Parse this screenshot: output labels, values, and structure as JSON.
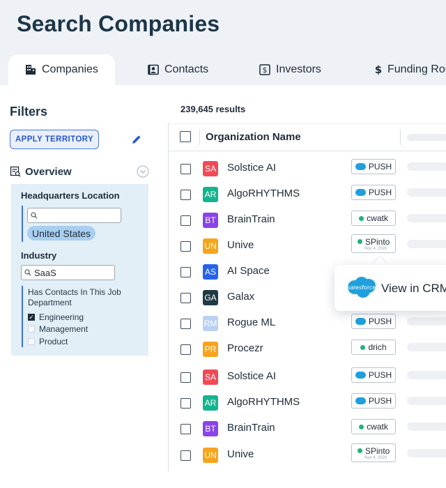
{
  "page": {
    "title": "Search Companies"
  },
  "tabs": [
    {
      "label": "Companies",
      "icon": "building-icon",
      "active": true
    },
    {
      "label": "Contacts",
      "icon": "contact-card-icon",
      "active": false
    },
    {
      "label": "Investors",
      "icon": "dollar-box-icon",
      "active": false
    },
    {
      "label": "Funding Rou",
      "icon": "dollar-icon",
      "active": false
    }
  ],
  "filters": {
    "title": "Filters",
    "apply_territory": "APPLY TERRITORY",
    "overview_label": "Overview",
    "hq_label": "Headquarters Location",
    "hq_search_value": "",
    "hq_chip": "United States",
    "industry_label": "Industry",
    "industry_value": "SaaS",
    "dept_label": "Has Contacts In This Job Department",
    "departments": [
      {
        "label": "Engineering",
        "checked": true
      },
      {
        "label": "Management",
        "checked": false
      },
      {
        "label": "Product",
        "checked": false
      }
    ]
  },
  "results": {
    "count": "239,645 results",
    "column_org": "Organization  Name",
    "rows": [
      {
        "initials": "SA",
        "color": "#ee4b57",
        "name": "Solstice AI",
        "badge_type": "salesforce",
        "badge": "PUSH",
        "badge_sub": ""
      },
      {
        "initials": "AR",
        "color": "#16b38f",
        "name": "AlgoRHYTHMS",
        "badge_type": "salesforce",
        "badge": "PUSH",
        "badge_sub": ""
      },
      {
        "initials": "BT",
        "color": "#8a44e8",
        "name": "BrainTrain",
        "badge_type": "user",
        "badge": "cwatk",
        "badge_sub": ""
      },
      {
        "initials": "UN",
        "color": "#f6a41d",
        "name": "Unive",
        "badge_type": "user-date",
        "badge": "SPinto",
        "badge_sub": "Nov 4, 2020"
      },
      {
        "initials": "AS",
        "color": "#2563eb",
        "name": "AI Space",
        "badge_type": "none",
        "badge": "",
        "badge_sub": ""
      },
      {
        "initials": "GA",
        "color": "#1f3a44",
        "name": "Galax",
        "badge_type": "none",
        "badge": "",
        "badge_sub": ""
      },
      {
        "initials": "RM",
        "color": "#b9d1f3",
        "name": "Rogue ML",
        "badge_type": "salesforce",
        "badge": "PUSH",
        "badge_sub": ""
      },
      {
        "initials": "PR",
        "color": "#f6a41d",
        "name": "Procezr",
        "badge_type": "user",
        "badge": "drich",
        "badge_sub": ""
      },
      {
        "initials": "SA",
        "color": "#ee4b57",
        "name": "Solstice AI",
        "badge_type": "salesforce",
        "badge": "PUSH",
        "badge_sub": ""
      },
      {
        "initials": "AR",
        "color": "#16b38f",
        "name": "AlgoRHYTHMS",
        "badge_type": "salesforce",
        "badge": "PUSH",
        "badge_sub": ""
      },
      {
        "initials": "BT",
        "color": "#8a44e8",
        "name": "BrainTrain",
        "badge_type": "user",
        "badge": "cwatk",
        "badge_sub": ""
      },
      {
        "initials": "UN",
        "color": "#f6a41d",
        "name": "Unive",
        "badge_type": "user-date",
        "badge": "SPinto",
        "badge_sub": "Nov 4, 2020"
      }
    ]
  },
  "popover": {
    "brand": "salesforce",
    "label": "View in CRM"
  },
  "colors": {
    "accent": "#2a57c8",
    "panel": "#e2eff6",
    "title": "#1d3548"
  }
}
